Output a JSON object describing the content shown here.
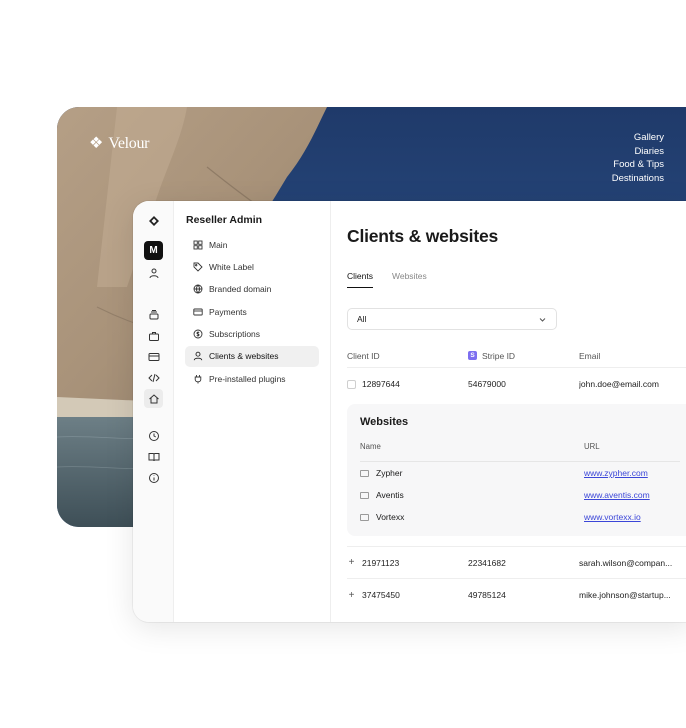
{
  "brand": {
    "mark": "❖",
    "name": "Velour"
  },
  "photo_nav": [
    "Gallery",
    "Diaries",
    "Food & Tips",
    "Destinations"
  ],
  "rail": {
    "avatar_letter": "M"
  },
  "sidebar": {
    "title": "Reseller Admin",
    "items": [
      {
        "label": "Main",
        "icon": "grid-icon"
      },
      {
        "label": "White Label",
        "icon": "tag-icon"
      },
      {
        "label": "Branded domain",
        "icon": "globe-icon"
      },
      {
        "label": "Payments",
        "icon": "card-icon"
      },
      {
        "label": "Subscriptions",
        "icon": "dollar-cycle-icon"
      },
      {
        "label": "Clients & websites",
        "icon": "user-icon",
        "active": true
      },
      {
        "label": "Pre-installed plugins",
        "icon": "plug-icon"
      }
    ]
  },
  "main": {
    "title": "Clients & websites",
    "tabs": [
      {
        "label": "Clients",
        "active": true
      },
      {
        "label": "Websites",
        "active": false
      }
    ],
    "filter": {
      "value": "All"
    },
    "table": {
      "headers": {
        "client_id": "Client ID",
        "stripe_id": "Stripe ID",
        "email": "Email"
      },
      "rows": [
        {
          "client_id": "12897644",
          "stripe_id": "54679000",
          "email": "john.doe@email.com"
        },
        {
          "client_id": "21971123",
          "stripe_id": "22341682",
          "email": "sarah.wilson@compan..."
        },
        {
          "client_id": "37475450",
          "stripe_id": "49785124",
          "email": "mike.johnson@startup..."
        }
      ]
    },
    "websites_panel": {
      "title": "Websites",
      "headers": {
        "name": "Name",
        "url": "URL"
      },
      "rows": [
        {
          "name": "Zypher",
          "url": "www.zypher.com"
        },
        {
          "name": "Aventis",
          "url": "www.aventis.com"
        },
        {
          "name": "Vortexx",
          "url": "www.vortexx.io"
        }
      ]
    }
  },
  "colors": {
    "sky": "#2c4f86",
    "link": "#3b46d8",
    "stripe": "#7c6ef0"
  }
}
